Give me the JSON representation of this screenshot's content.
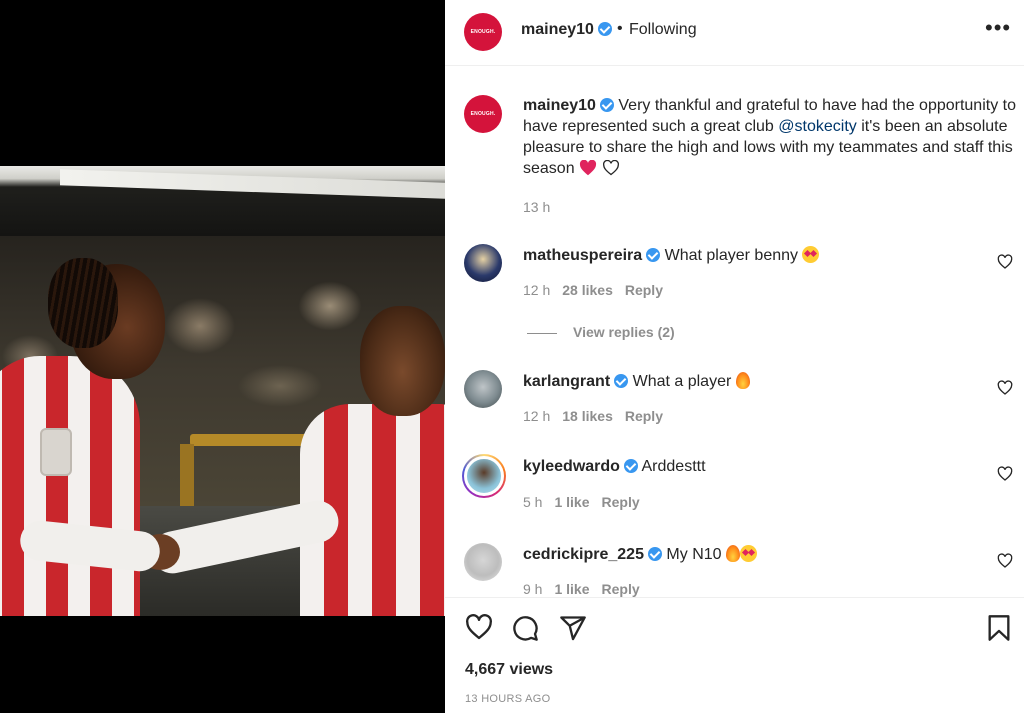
{
  "post": {
    "username": "mainey10",
    "follow_status": "Following",
    "separator": "•",
    "avatar_text": "ENOUGH."
  },
  "caption": {
    "username": "mainey10",
    "text_before": " Very thankful and grateful to have had the opportunity to have represented such a great club ",
    "mention": "@stokecity",
    "text_after": " it's been an absolute pleasure to share the high and lows with my teammates and staff this season ",
    "time": "13 h"
  },
  "comments": [
    {
      "username": "matheuspereira",
      "text": " What player benny ",
      "emoji": "star-struck",
      "time": "12 h",
      "likes": "28 likes",
      "reply": "Reply"
    },
    {
      "username": "karlangrant",
      "text": " What a player ",
      "emoji": "fire",
      "time": "12 h",
      "likes": "18 likes",
      "reply": "Reply"
    },
    {
      "username": "kyleedwardo",
      "text": " Arddesttt",
      "emoji": "",
      "time": "5 h",
      "likes": "1 like",
      "reply": "Reply"
    },
    {
      "username": "cedrickipre_225",
      "text": " My N10 ",
      "emoji": "fire+star-struck",
      "time": "9 h",
      "likes": "1 like",
      "reply": "Reply"
    }
  ],
  "view_replies": "View replies (2)",
  "footer": {
    "views": "4,667 views",
    "posted": "13 HOURS AGO"
  },
  "colors": {
    "brand_avatar": "#d4133b",
    "verified": "#3897f0",
    "mention": "#00376b",
    "muted": "#8e8e8e"
  },
  "icons": [
    "more-icon",
    "verified-icon",
    "heart-icon",
    "comment-icon",
    "share-icon",
    "bookmark-icon"
  ]
}
